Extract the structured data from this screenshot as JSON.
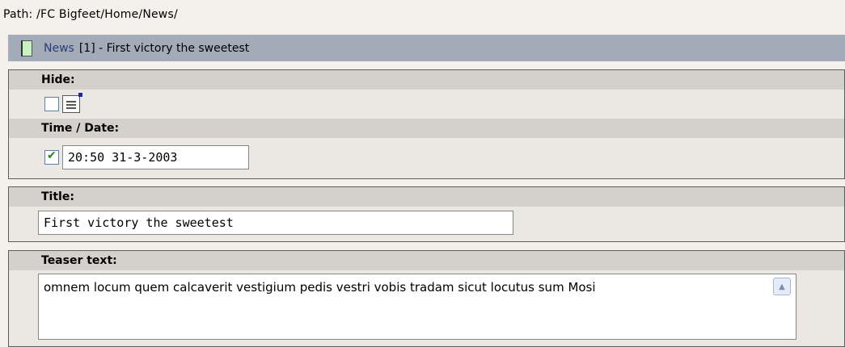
{
  "path": "Path: /FC Bigfeet/Home/News/",
  "record": {
    "table_name": "News",
    "rest": "[1] - First victory the sweetest"
  },
  "group1": {
    "hide_label": "Hide:",
    "time_label": "Time / Date:",
    "time_value": "20:50 31-3-2003"
  },
  "group2": {
    "title_label": "Title:",
    "title_value": "First victory the sweetest"
  },
  "group3": {
    "teaser_label": "Teaser text:",
    "teaser_value": "omnem locum quem calcaverit vestigium pedis vestri vobis tradam sicut locutus sum Mosi"
  },
  "icons": {
    "record": "page-icon",
    "clipboard": "clipboard-icon",
    "scroll": "scroll-up-icon"
  },
  "colors": {
    "record_header_bg": "#a3abb8",
    "label_row_bg": "#d4d1cc",
    "field_row_bg": "#ebe8e3",
    "checkmark": "#1a8a1a"
  }
}
